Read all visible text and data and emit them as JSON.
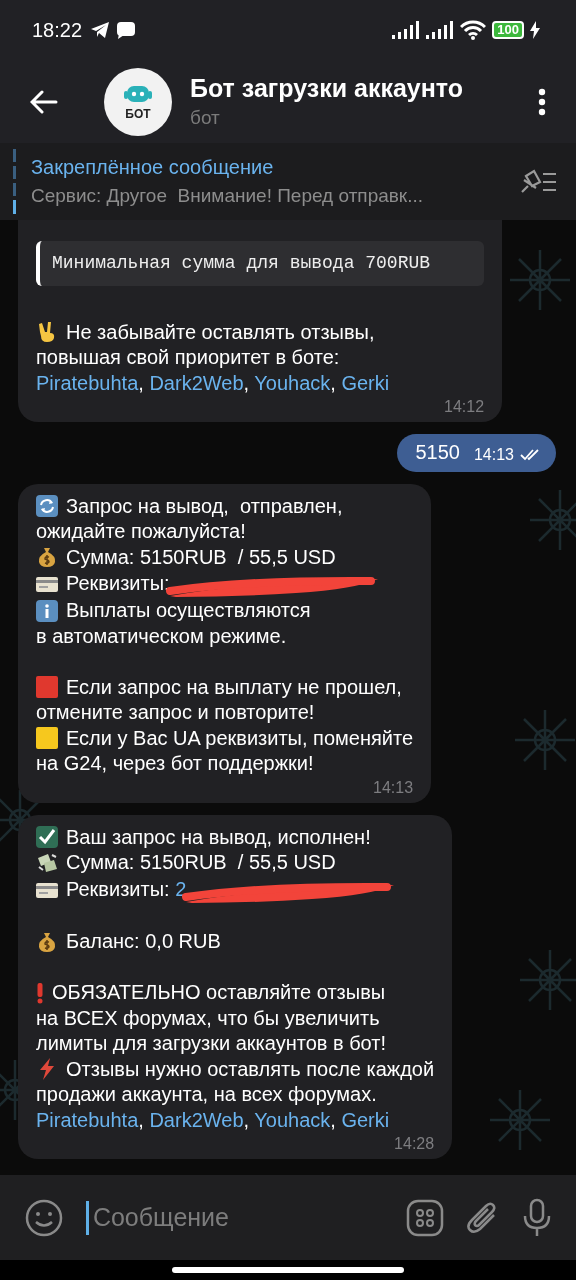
{
  "status_bar": {
    "time": "18:22",
    "battery": "100"
  },
  "header": {
    "title": "Бот загрузки аккаунто",
    "subtitle": "бот",
    "avatar_text": "БОТ"
  },
  "pinned": {
    "title": "Закреплённое сообщение",
    "preview": "Сервис: Другое  Внимание! Перед отправк..."
  },
  "messages": [
    {
      "outgoing": false,
      "cut_top": true,
      "time": "14:12",
      "paragraphs": [
        {
          "kind": "code",
          "lines": [
            "Минимальная сумма для вывода 700RUB"
          ]
        },
        {
          "kind": "blank"
        },
        {
          "kind": "peace",
          "lines": [
            "Не забывайте оставлять отзывы,",
            "повышая свой приоритет в боте:"
          ]
        },
        {
          "kind": "plain",
          "lines": [
            [
              {
                "text": "Piratebuhta",
                "kind": "link"
              },
              {
                "text": ", ",
                "kind": "text"
              },
              {
                "text": "Dark2Web",
                "kind": "link"
              },
              {
                "text": ", ",
                "kind": "text"
              },
              {
                "text": "Youhack",
                "kind": "link"
              },
              {
                "text": ", ",
                "kind": "text"
              },
              {
                "text": "Gerki",
                "kind": "link"
              }
            ]
          ]
        }
      ]
    },
    {
      "outgoing": true,
      "cut_top": false,
      "time": "14:13",
      "read": true,
      "paragraphs": [
        {
          "kind": "plain",
          "lines": [
            "5150"
          ]
        }
      ]
    },
    {
      "outgoing": false,
      "cut_top": false,
      "time": "14:13",
      "paragraphs": [
        {
          "kind": "refresh",
          "lines": [
            "Запрос на вывод,  отправлен,",
            "ожидайте пожалуйста!"
          ]
        },
        {
          "kind": "moneybag",
          "lines": [
            "Сумма: 5150RUB  / 55,5 USD"
          ]
        },
        {
          "kind": "card",
          "redacted": true,
          "lines": [
            "Реквизиты:"
          ]
        },
        {
          "kind": "info",
          "lines": [
            "Выплаты осуществляются",
            "в автоматическом режиме."
          ]
        },
        {
          "kind": "blank"
        },
        {
          "kind": "red_square",
          "lines": [
            "Если запрос на выплату не прошел,",
            "отмените запрос и повторите!"
          ]
        },
        {
          "kind": "yellow_square",
          "lines": [
            "Если у Вас UA реквизиты, поменяйте",
            "на G24, через бот поддержки!"
          ]
        }
      ]
    },
    {
      "outgoing": false,
      "cut_top": false,
      "time": "14:28",
      "paragraphs": [
        {
          "kind": "check",
          "lines": [
            "Ваш запрос на вывод, исполнен!"
          ]
        },
        {
          "kind": "flying_money",
          "lines": [
            "Сумма: 5150RUB  / 55,5 USD"
          ]
        },
        {
          "kind": "card",
          "redacted": true,
          "lines": [
            [
              {
                "text": "Реквизиты: ",
                "kind": "text"
              },
              {
                "text": "2",
                "kind": "link"
              }
            ]
          ]
        },
        {
          "kind": "blank"
        },
        {
          "kind": "moneybag",
          "lines": [
            "Баланс: 0,0 RUB"
          ]
        },
        {
          "kind": "blank"
        },
        {
          "kind": "exclamation",
          "lines": [
            "ОБЯЗАТЕЛЬНО оставляйте отзывы",
            "на ВСЕХ форумах, что бы увеличить",
            "лимиты для загрузки аккаунтов в бот!"
          ]
        },
        {
          "kind": "lightning",
          "lines": [
            "Отзывы нужно оставлять после каждой",
            "продажи аккаунта, на всех форумах."
          ]
        },
        {
          "kind": "plain",
          "lines": [
            [
              {
                "text": "Piratebuhta",
                "kind": "link"
              },
              {
                "text": ", ",
                "kind": "text"
              },
              {
                "text": "Dark2Web",
                "kind": "link"
              },
              {
                "text": ", ",
                "kind": "text"
              },
              {
                "text": "Youhack",
                "kind": "link"
              },
              {
                "text": ", ",
                "kind": "text"
              },
              {
                "text": "Gerki",
                "kind": "link"
              }
            ]
          ]
        }
      ]
    }
  ],
  "composer": {
    "placeholder": "Сообщение"
  }
}
